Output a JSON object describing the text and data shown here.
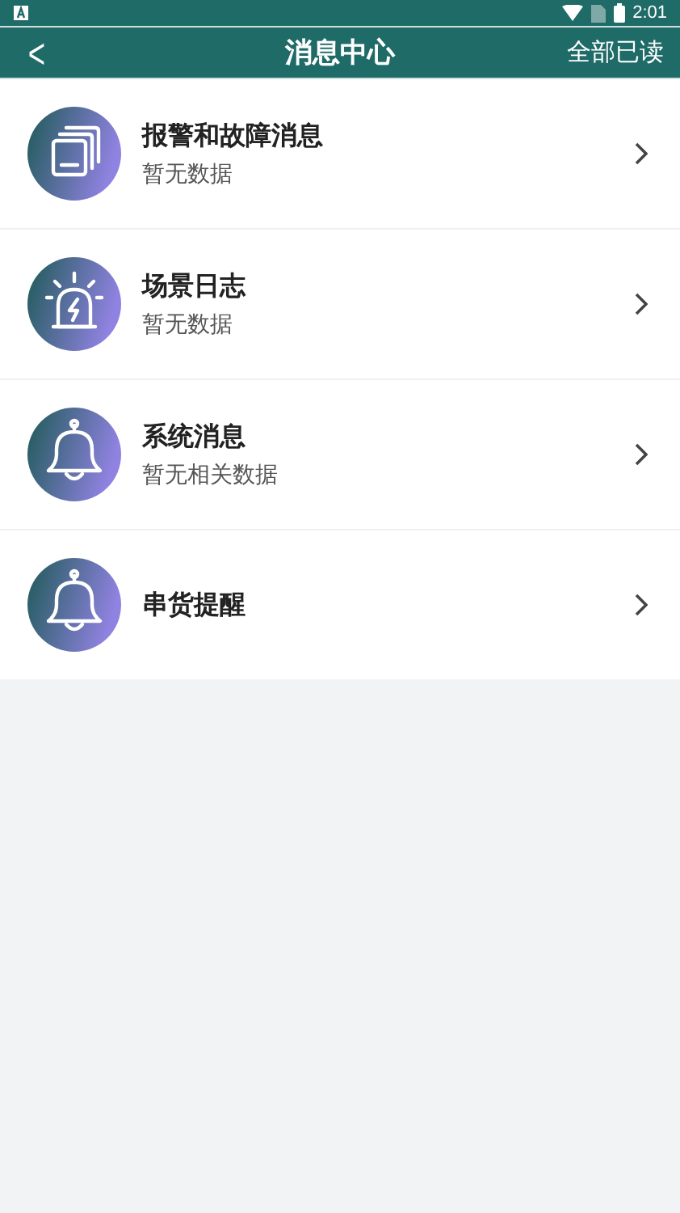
{
  "status_bar": {
    "time": "2:01"
  },
  "header": {
    "back": "<",
    "title": "消息中心",
    "action": "全部已读"
  },
  "items": [
    {
      "kind": "stack",
      "title": "报警和故障消息",
      "subtitle": "暂无数据"
    },
    {
      "kind": "beacon",
      "title": "场景日志",
      "subtitle": "暂无数据"
    },
    {
      "kind": "bell",
      "title": "系统消息",
      "subtitle": "暂无相关数据"
    },
    {
      "kind": "bell",
      "title": "串货提醒"
    }
  ]
}
